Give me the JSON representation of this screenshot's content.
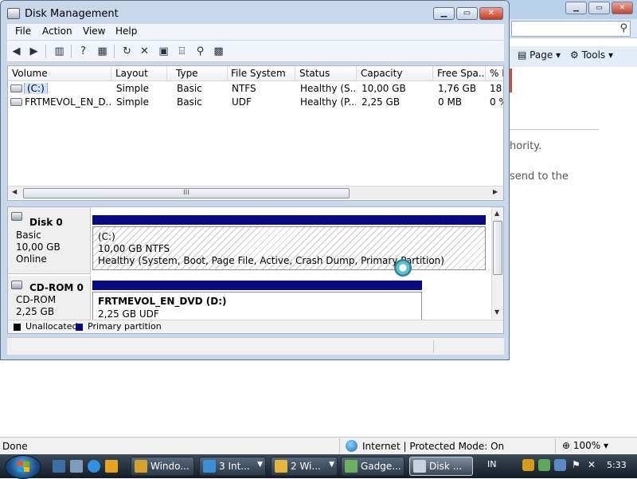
{
  "disk_management": {
    "title": "Disk Management",
    "menu": [
      "File",
      "Action",
      "View",
      "Help"
    ],
    "columns": [
      "Volume",
      "Layout",
      "Type",
      "File System",
      "Status",
      "Capacity",
      "Free Spa...",
      "% F"
    ],
    "volumes": [
      {
        "name": "(C:)",
        "layout": "Simple",
        "type": "Basic",
        "fs": "NTFS",
        "status": "Healthy (S...",
        "capacity": "10,00 GB",
        "free": "1,76 GB",
        "pct": "18"
      },
      {
        "name": "FRTMEVOL_EN_D...",
        "layout": "Simple",
        "type": "Basic",
        "fs": "UDF",
        "status": "Healthy (P...",
        "capacity": "2,25 GB",
        "free": "0 MB",
        "pct": "0 %"
      }
    ],
    "disks": [
      {
        "name": "Disk 0",
        "kind": "Basic",
        "size": "10,00 GB",
        "state": "Online",
        "partition": {
          "name": "(C:)",
          "size_fs": "10,00 GB NTFS",
          "status": "Healthy (System, Boot, Page File, Active, Crash Dump, Primary Partition)"
        }
      },
      {
        "name": "CD-ROM 0",
        "kind": "CD-ROM",
        "size": "2,25 GB",
        "state": "",
        "partition": {
          "name": "FRTMEVOL_EN_DVD  (D:)",
          "size_fs": "2,25 GB UDF",
          "status": ""
        }
      }
    ],
    "legend": [
      {
        "label": "Unallocated",
        "color": "#000000"
      },
      {
        "label": "Primary partition",
        "color": "#0a0a80"
      }
    ],
    "hscroll_grip": "III"
  },
  "ie": {
    "toolbar": {
      "page": "Page",
      "tools": "Tools"
    },
    "text_fragments": [
      "hority.",
      "send to the"
    ],
    "status_done": "Done",
    "status_zone": "Internet | Protected Mode: On",
    "zoom": "100%"
  },
  "taskbar": {
    "buttons": [
      {
        "label": "Windo...",
        "icon": "shield-icon",
        "color": "#d8a22a"
      },
      {
        "label": "3 Int...",
        "icon": "ie-icon",
        "color": "#3b8fd6",
        "arrow": true
      },
      {
        "label": "2 Wi...",
        "icon": "folder-icon",
        "color": "#e5b53c",
        "arrow": true
      },
      {
        "label": "Gadge...",
        "icon": "gadget-icon",
        "color": "#6bb05c"
      },
      {
        "label": "Disk ...",
        "icon": "disk-management-icon",
        "color": "#c7d2de",
        "active": true
      }
    ],
    "lang": "IN",
    "clock": "5:33"
  },
  "colors": {
    "primary_partition": "#0a0a80",
    "selection": "#cfe3fb"
  }
}
